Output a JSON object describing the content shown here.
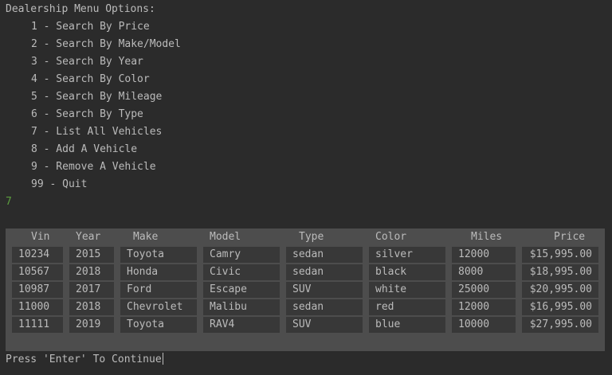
{
  "menu": {
    "title": "Dealership Menu Options:",
    "items": [
      "1 - Search By Price",
      "2 - Search By Make/Model",
      "3 - Search By Year",
      "4 - Search By Color",
      "5 - Search By Mileage",
      "6 - Search By Type",
      "7 - List All Vehicles",
      "8 - Add A Vehicle",
      "9 - Remove A Vehicle",
      "99 - Quit"
    ]
  },
  "user_input": "7",
  "table": {
    "headers": [
      "Vin",
      "Year",
      "Make",
      "Model",
      "Type",
      "Color",
      "Miles",
      "Price"
    ],
    "rows": [
      [
        "10234",
        "2015",
        "Toyota",
        "Camry",
        "sedan",
        "silver",
        "12000",
        "$15,995.00"
      ],
      [
        "10567",
        "2018",
        "Honda",
        "Civic",
        "sedan",
        "black",
        "8000",
        "$18,995.00"
      ],
      [
        "10987",
        "2017",
        "Ford",
        "Escape",
        "SUV",
        "white",
        "25000",
        "$20,995.00"
      ],
      [
        "11000",
        "2018",
        "Chevrolet",
        "Malibu",
        "sedan",
        "red",
        "12000",
        "$16,995.00"
      ],
      [
        "11111",
        "2019",
        "Toyota",
        "RAV4",
        "SUV",
        "blue",
        "10000",
        "$27,995.00"
      ]
    ]
  },
  "prompt": "Press 'Enter' To Continue",
  "colors": {
    "background": "#2b2b2b",
    "text": "#bbbbbb",
    "input_echo": "#5c9e3f",
    "table_bg": "#4d4d4d",
    "cell_bg": "#383838"
  }
}
